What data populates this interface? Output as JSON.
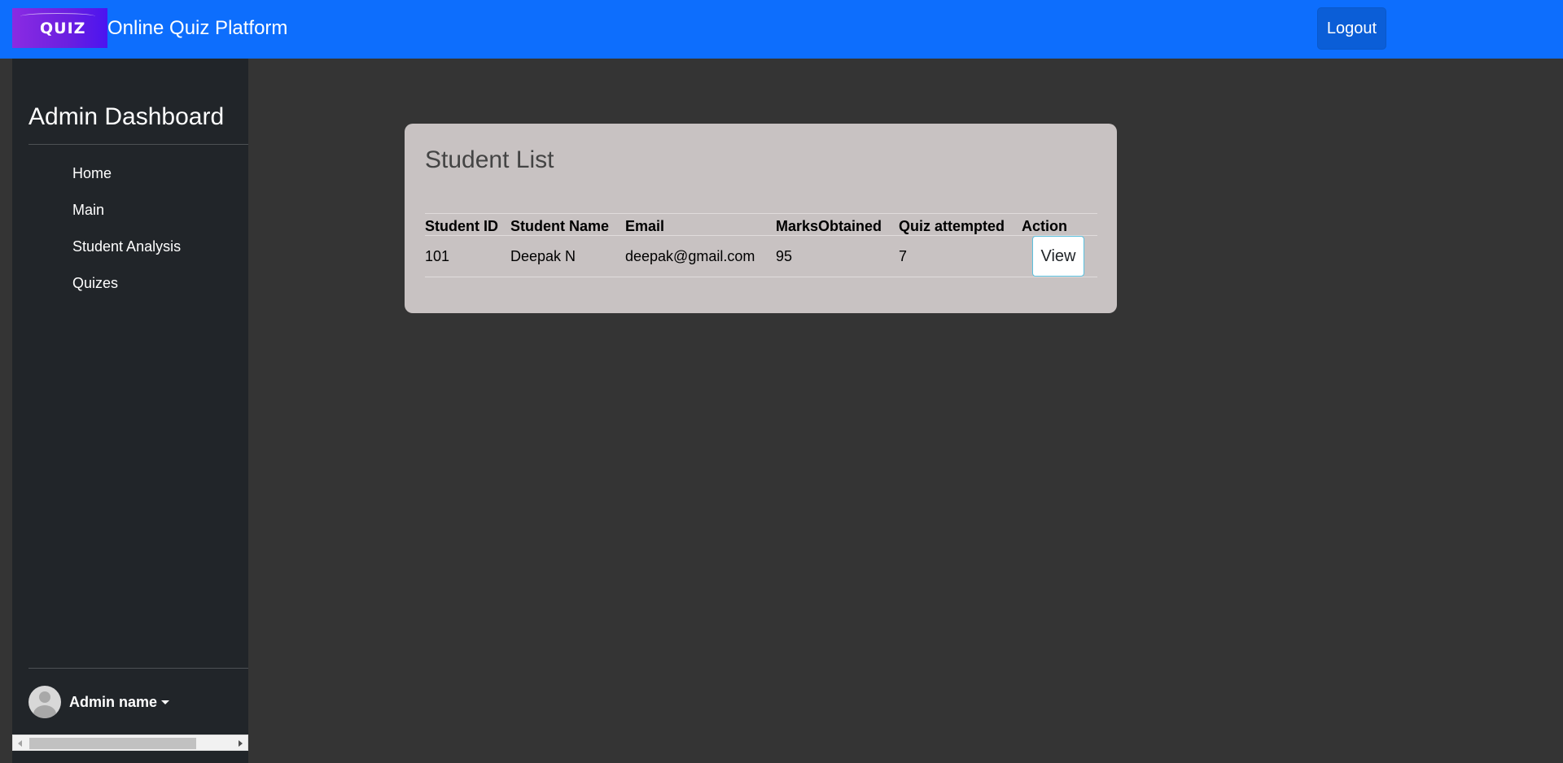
{
  "header": {
    "logo_text": "QUIZ",
    "brand": "Online Quiz Platform",
    "logout_label": "Logout"
  },
  "sidebar": {
    "title": "Admin Dashboard",
    "items": [
      {
        "label": "Home"
      },
      {
        "label": "Main"
      },
      {
        "label": "Student Analysis"
      },
      {
        "label": "Quizes"
      }
    ],
    "user": {
      "name": "Admin name"
    }
  },
  "main": {
    "card_title": "Student List",
    "columns": [
      "Student ID",
      "Student Name",
      "Email",
      "MarksObtained",
      "Quiz attempted",
      "Action"
    ],
    "rows": [
      {
        "id": "101",
        "name": "Deepak N",
        "email": "deepak@gmail.com",
        "marks": "95",
        "quiz_attempted": "7",
        "action": "View"
      }
    ]
  },
  "colors": {
    "navbar": "#0d6efd",
    "sidebar": "#212529",
    "background": "#343434",
    "card": "#c8c2c2",
    "view_border": "#5bc0de"
  }
}
